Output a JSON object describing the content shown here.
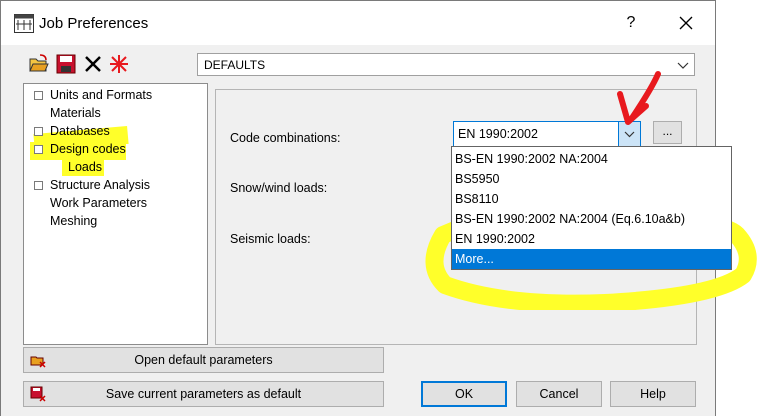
{
  "window": {
    "title": "Job Preferences",
    "help_label": "?"
  },
  "toolbar": {
    "icons": [
      "open-folder-icon",
      "save-icon",
      "delete-icon",
      "reset-star-icon"
    ],
    "profile_value": "DEFAULTS"
  },
  "tree": {
    "items": [
      {
        "label": "Units and Formats",
        "expandable": true
      },
      {
        "label": "Materials",
        "expandable": false
      },
      {
        "label": "Databases",
        "expandable": true
      },
      {
        "label": "Design codes",
        "expandable": true,
        "expanded": true
      },
      {
        "label": "Loads",
        "expandable": false,
        "selected": true
      },
      {
        "label": "Structure Analysis",
        "expandable": true
      },
      {
        "label": "Work Parameters",
        "expandable": false
      },
      {
        "label": "Meshing",
        "expandable": false
      }
    ]
  },
  "form": {
    "code_combinations_label": "Code combinations:",
    "code_combinations_value": "EN 1990:2002",
    "browse_label": "...",
    "snow_wind_label": "Snow/wind loads:",
    "seismic_label": "Seismic loads:"
  },
  "dropdown": {
    "options": [
      "BS-EN 1990:2002 NA:2004",
      "BS5950",
      "BS8110",
      "BS-EN 1990:2002 NA:2004 (Eq.6.10a&b)",
      "EN 1990:2002",
      "More..."
    ],
    "highlighted_index": 5
  },
  "buttons": {
    "open_default": "Open default parameters",
    "save_default": "Save current parameters as default",
    "ok": "OK",
    "cancel": "Cancel",
    "help": "Help"
  },
  "colors": {
    "annotation_highlight": "#ffff2a",
    "annotation_arrow": "#e8191e",
    "selection_blue": "#0078d7"
  }
}
